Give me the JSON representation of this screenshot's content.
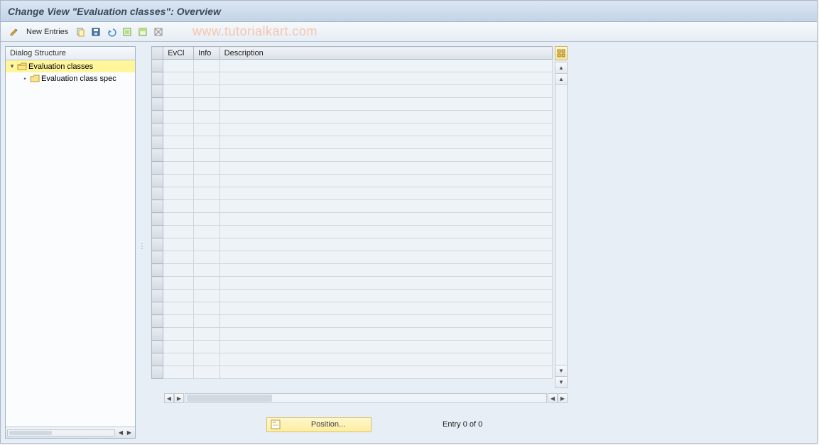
{
  "title": "Change View \"Evaluation classes\": Overview",
  "watermark": "www.tutorialkart.com",
  "toolbar": {
    "new_entries": "New Entries"
  },
  "sidebar": {
    "header": "Dialog Structure",
    "items": [
      {
        "label": "Evaluation classes",
        "selected": true,
        "open": true
      },
      {
        "label": "Evaluation class spec",
        "selected": false,
        "child": true
      }
    ]
  },
  "grid": {
    "columns": {
      "evcl": "EvCl",
      "info": "Info",
      "desc": "Description"
    },
    "row_count": 25,
    "rows": []
  },
  "footer": {
    "position_label": "Position...",
    "entry_text": "Entry 0 of 0"
  }
}
